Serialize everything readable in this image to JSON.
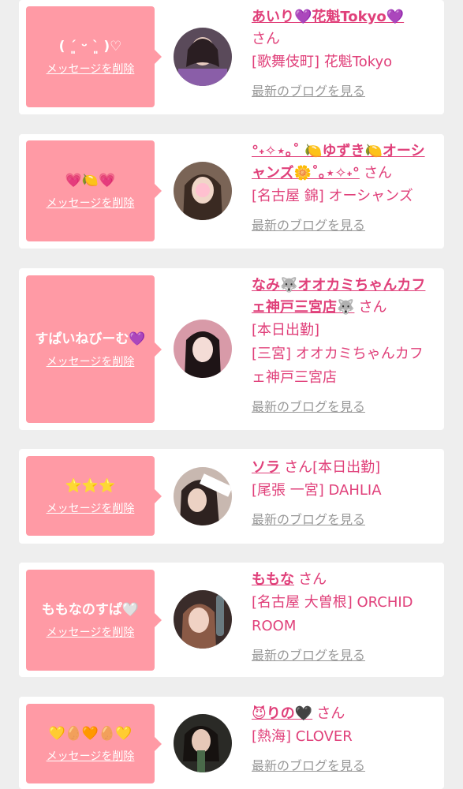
{
  "colors": {
    "bubble": "#ff9aa5",
    "accent": "#e0407a",
    "muted": "#999999",
    "background": "#eeeeee"
  },
  "common": {
    "delete_label": "メッセージを削除",
    "san": "さん",
    "blog_label": "最新のブログを見る"
  },
  "cards": [
    {
      "message": "( ´͈ ᵕ `͈ )♡",
      "name": "あいり💜花魁Tokyo💜",
      "details": [
        "[歌舞伎町] 花魁Tokyo"
      ]
    },
    {
      "message": "💗🍋💗",
      "name": "°˖✧⋆｡˚ 🍋ゆずき🍋オーシャンズ🌼˚｡⋆✧˖°",
      "details": [
        "[名古屋 錦] オーシャンズ"
      ]
    },
    {
      "message": "すぱいねびーむ💜",
      "name": "なみ🐺オオカミちゃんカフェ神戸三宮店🐺",
      "details": [
        "[本日出勤]",
        "[三宮] オオカミちゃんカフェ神戸三宮店"
      ]
    },
    {
      "message": "⭐⭐⭐",
      "name": "ソラ",
      "details": [
        "[尾張 一宮] DAHLIA"
      ],
      "badge": "[本日出勤]"
    },
    {
      "message": "ももなのすぱ🤍",
      "name": "ももな",
      "details": [
        "[名古屋 大曽根] ORCHID ROOM"
      ]
    },
    {
      "message": "💛🥚🧡🥚💛",
      "name": "😈りの🖤",
      "details": [
        "[熱海] CLOVER"
      ]
    }
  ]
}
